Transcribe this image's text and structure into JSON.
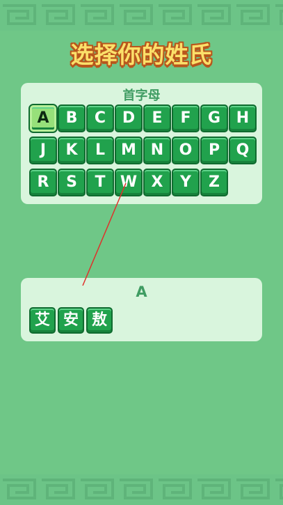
{
  "title": "选择你的姓氏",
  "letter_panel": {
    "heading": "首字母",
    "letters": [
      "A",
      "B",
      "C",
      "D",
      "E",
      "F",
      "G",
      "H",
      "J",
      "K",
      "L",
      "M",
      "N",
      "O",
      "P",
      "Q",
      "R",
      "S",
      "T",
      "W",
      "X",
      "Y",
      "Z"
    ],
    "selected": "A"
  },
  "surname_panel": {
    "heading": "A",
    "surnames": [
      "艾",
      "安",
      "敖"
    ]
  },
  "colors": {
    "background": "#6fc787",
    "panel": "#d9f5dd",
    "key": "#21a24d",
    "key_border": "#0f6b2f",
    "title_fill": "#fbe06a",
    "title_outline": "#b8561c",
    "annotation_line": "#e0302a"
  }
}
